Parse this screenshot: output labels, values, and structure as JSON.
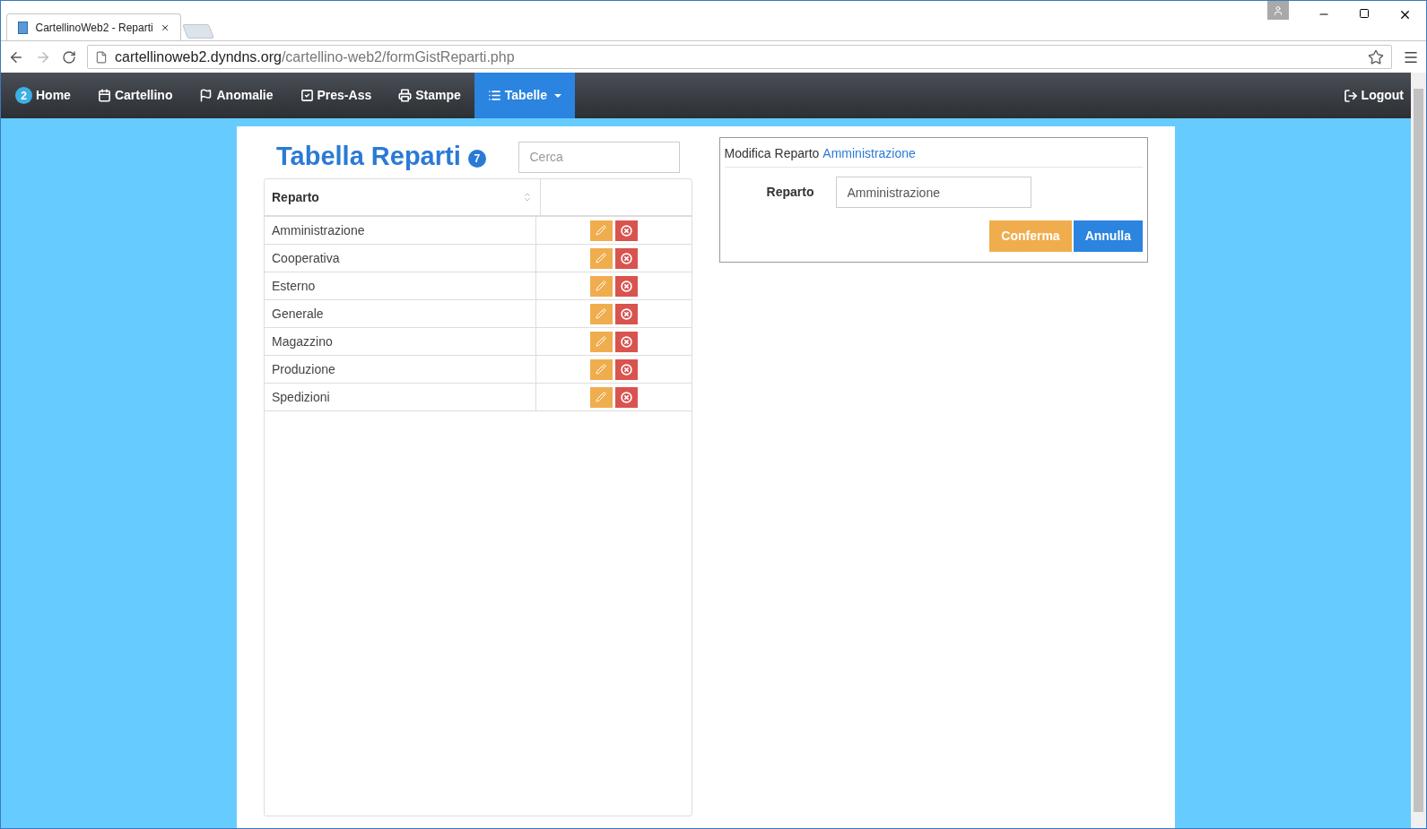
{
  "browser": {
    "tab_title": "CartellinoWeb2 - Reparti",
    "url_host": "cartellinoweb2.dyndns.org",
    "url_path": "/cartellino-web2/formGistReparti.php"
  },
  "navbar": {
    "items": [
      {
        "kind": "home",
        "label": "Home",
        "badge": "2",
        "selected": false,
        "dropdown": false
      },
      {
        "kind": "calendar",
        "label": "Cartellino",
        "selected": false,
        "dropdown": false
      },
      {
        "kind": "flag",
        "label": "Anomalie",
        "selected": false,
        "dropdown": false
      },
      {
        "kind": "check",
        "label": "Pres-Ass",
        "selected": false,
        "dropdown": false
      },
      {
        "kind": "print",
        "label": "Stampe",
        "selected": false,
        "dropdown": false
      },
      {
        "kind": "list",
        "label": "Tabelle",
        "selected": true,
        "dropdown": true
      }
    ],
    "logout": "Logout"
  },
  "table_panel": {
    "title": "Tabella Reparti",
    "count": "7",
    "search": {
      "placeholder": "Cerca"
    },
    "columns": [
      "Reparto"
    ],
    "rows": [
      {
        "name": "Amministrazione"
      },
      {
        "name": "Cooperativa"
      },
      {
        "name": "Esterno"
      },
      {
        "name": "Generale"
      },
      {
        "name": "Magazzino"
      },
      {
        "name": "Produzione"
      },
      {
        "name": "Spedizioni"
      }
    ]
  },
  "edit_panel": {
    "heading": "Modifica Reparto",
    "heading_value": "Amministrazione",
    "field_label": "Reparto",
    "field_value": "Amministrazione",
    "buttons": [
      {
        "kind": "confirm",
        "label": "Conferma"
      },
      {
        "kind": "cancel",
        "label": "Annulla"
      }
    ]
  }
}
